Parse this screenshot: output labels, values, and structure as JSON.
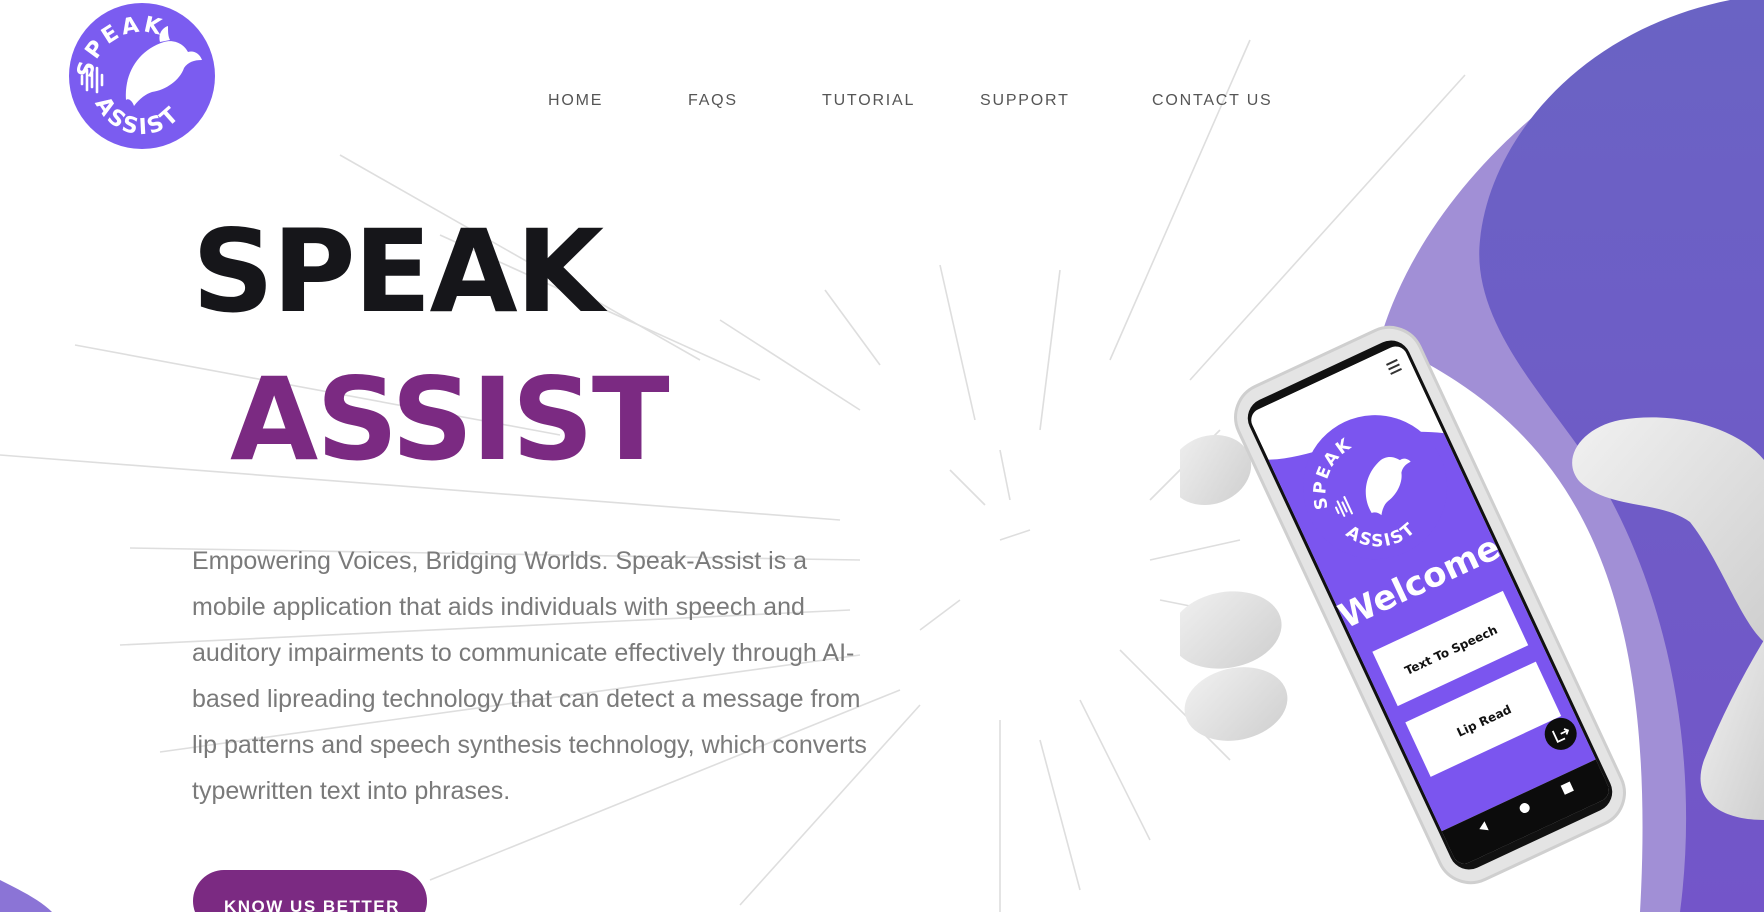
{
  "brand": {
    "logo_text_top": "SPEAK",
    "logo_text_bottom": "ASSIST",
    "colors": {
      "logo_purple": "#7b5cf0",
      "title_dark": "#16161a",
      "title_purple": "#7b2a82",
      "button_purple": "#7b2a82",
      "blob_purple": "#6d5fc7",
      "text_gray": "#7a7a7a"
    }
  },
  "nav": {
    "items": [
      {
        "label": "HOME"
      },
      {
        "label": "FAQS"
      },
      {
        "label": "TUTORIAL"
      },
      {
        "label": "SUPPORT"
      },
      {
        "label": "CONTACT US"
      }
    ]
  },
  "hero": {
    "title_line1": "SPEAK",
    "title_line2": "ASSIST",
    "description": "Empowering Voices, Bridging Worlds. Speak-Assist is a mobile application that aids individuals with speech and auditory impairments to communicate effectively through AI-based lipreading technology that can detect a message from lip patterns and speech synthesis technology, which converts typewritten text into phrases.",
    "cta_label": "KNOW US BETTER"
  },
  "phone": {
    "logo_text_top": "SPEAK",
    "logo_text_bottom": "ASSIST",
    "welcome": "Welcome",
    "buttons": [
      {
        "label": "Text To Speech"
      },
      {
        "label": "Lip Read"
      }
    ],
    "icons": [
      "menu-icon",
      "logout-icon",
      "back-icon",
      "home-icon",
      "recents-icon",
      "sound-wave-icon",
      "dolphin-icon"
    ]
  }
}
